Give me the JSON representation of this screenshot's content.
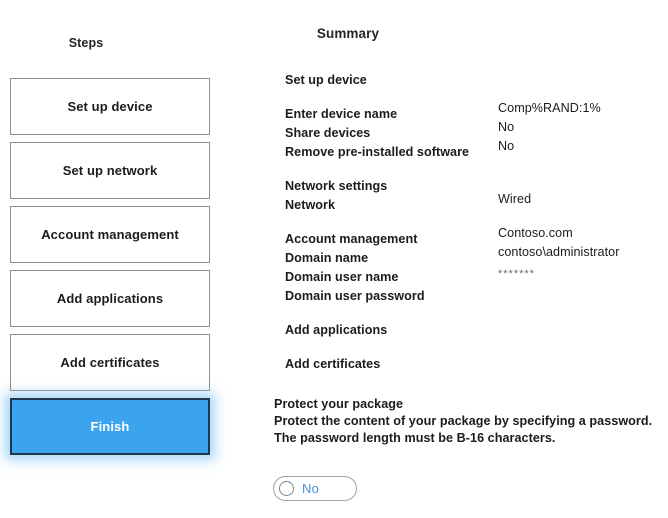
{
  "steps": {
    "heading": "Steps",
    "items": [
      {
        "label": "Set up device",
        "active": false
      },
      {
        "label": "Set up network",
        "active": false
      },
      {
        "label": "Account management",
        "active": false
      },
      {
        "label": "Add applications",
        "active": false
      },
      {
        "label": "Add certificates",
        "active": false
      },
      {
        "label": "Finish",
        "active": true
      }
    ]
  },
  "summary": {
    "heading": "Summary",
    "groups": [
      {
        "head": "Set up device",
        "rows": []
      },
      {
        "head": null,
        "rows": [
          {
            "label": "Enter device name",
            "value": "Comp%RAND:1%",
            "masked": false
          },
          {
            "label": "Share devices",
            "value": "No",
            "masked": false
          },
          {
            "label": "Remove pre-installed software",
            "value": "No",
            "masked": false
          }
        ]
      },
      {
        "head": null,
        "rows": [
          {
            "label": "Network settings",
            "value": "",
            "masked": false
          },
          {
            "label": "Network",
            "value": "Wired",
            "masked": false
          }
        ]
      },
      {
        "head": null,
        "rows": [
          {
            "label": "Account management",
            "value": "Contoso.com",
            "masked": false
          },
          {
            "label": "Domain name",
            "value": "contoso\\administrator",
            "masked": false
          },
          {
            "label": "Domain user name",
            "value": "*******",
            "masked": true
          },
          {
            "label": "Domain user password",
            "value": "",
            "masked": false
          }
        ]
      },
      {
        "head": "Add applications",
        "rows": []
      },
      {
        "head": "Add certificates",
        "rows": []
      }
    ]
  },
  "protect": {
    "title": "Protect your package",
    "line2": "Protect the content of your package by specifying a password.",
    "line3": "The password length must be B-16 characters.",
    "toggle_label": "No",
    "toggle_state": "off"
  },
  "colors": {
    "accent_blue": "#3ba4ef",
    "toggle_text": "#4a90d9",
    "box_border": "#8d8d8d",
    "active_border": "#20364d",
    "background": "#ffffff"
  }
}
